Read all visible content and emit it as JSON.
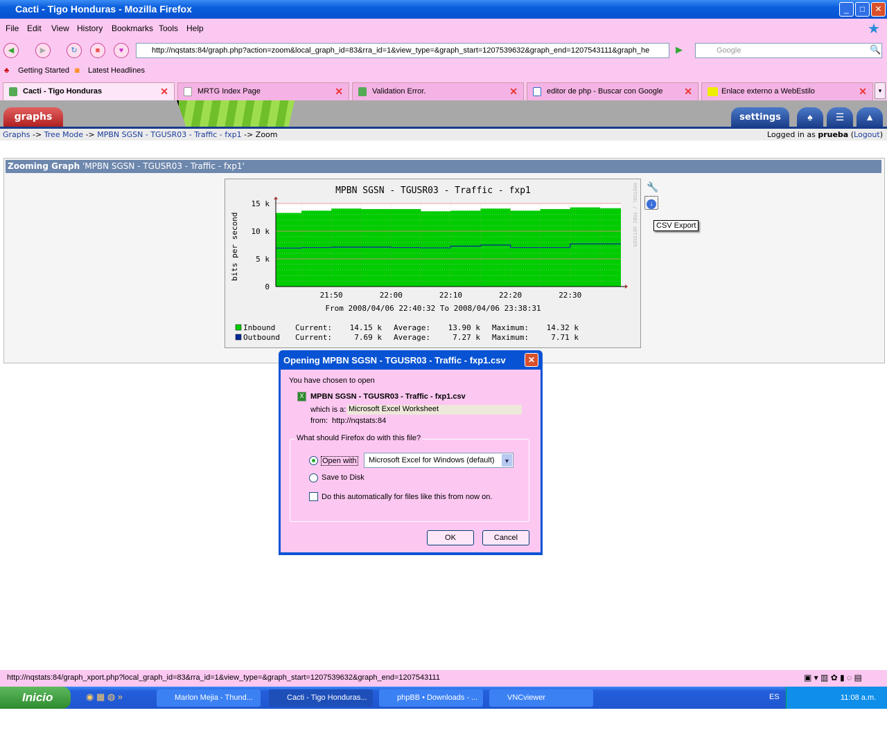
{
  "window": {
    "title": "Cacti - Tigo Honduras - Mozilla Firefox"
  },
  "menu": [
    "File",
    "Edit",
    "View",
    "History",
    "Bookmarks",
    "Tools",
    "Help"
  ],
  "url": "http://nqstats:84/graph.php?action=zoom&local_graph_id=83&rra_id=1&view_type=&graph_start=1207539632&graph_end=1207543111&graph_he",
  "search_placeholder": "Google",
  "bookmarks": [
    "Getting Started",
    "Latest Headlines"
  ],
  "tabs": [
    {
      "label": "Cacti - Tigo Honduras",
      "active": true
    },
    {
      "label": "MRTG Index Page"
    },
    {
      "label": "Validation Error."
    },
    {
      "label": "editor de php - Buscar con Google"
    },
    {
      "label": "Enlace externo a WebEstilo"
    }
  ],
  "cacti": {
    "graphs_tab": "graphs",
    "settings_tab": "settings",
    "breadcrumb": [
      "Graphs",
      "Tree Mode",
      "MPBN SGSN - TGUSR03 - Traffic - fxp1",
      "Zoom"
    ],
    "sep": "->",
    "logged_in_prefix": "Logged in as",
    "user": "prueba",
    "logout": "Logout",
    "zoom_heading": "Zooming Graph",
    "zoom_graph_name": "'MPBN SGSN - TGUSR03 - Traffic - fxp1'",
    "tooltip": "CSV Export"
  },
  "chart_data": {
    "type": "area",
    "title": "MPBN SGSN - TGUSR03 - Traffic - fxp1",
    "ylabel": "bits per second",
    "watermark": "RRDTOOL / TOBI OETIKER",
    "subtitle": "From 2008/04/06 22:40:32 To 2008/04/06 23:38:31",
    "yticks": [
      "0",
      "5 k",
      "10 k",
      "15 k"
    ],
    "ylim": [
      0,
      15000
    ],
    "xticks": [
      "21:50",
      "22:00",
      "22:10",
      "22:20",
      "22:30"
    ],
    "xlim": [
      "21:40:42",
      "22:38:30"
    ],
    "grid": true,
    "series": [
      {
        "name": "Inbound",
        "color": "#00cc00",
        "style": "area",
        "step_starts": [
          "21:40:42",
          "21:45",
          "21:50",
          "21:55",
          "22:05",
          "22:10",
          "22:15",
          "22:20",
          "22:25",
          "22:30",
          "22:35"
        ],
        "values": [
          13300,
          13700,
          14100,
          14000,
          13600,
          13700,
          14100,
          13700,
          14000,
          14300,
          14150
        ]
      },
      {
        "name": "Outbound",
        "color": "#002a97",
        "style": "line",
        "step_starts": [
          "21:40:42",
          "21:45",
          "21:50",
          "22:00",
          "22:05",
          "22:10",
          "22:15",
          "22:20",
          "22:30"
        ],
        "values": [
          6950,
          7050,
          7100,
          7050,
          7000,
          7300,
          7500,
          7050,
          7700
        ]
      }
    ],
    "legend": [
      {
        "name": "Inbound",
        "current": "14.15 k",
        "average": "13.90 k",
        "maximum": "14.32 k"
      },
      {
        "name": "Outbound",
        "current": "7.69 k",
        "average": "7.27 k",
        "maximum": "7.71 k"
      }
    ],
    "legend_labels": {
      "current": "Current:",
      "average": "Average:",
      "maximum": "Maximum:"
    }
  },
  "dialog": {
    "title": "Opening MPBN SGSN - TGUSR03 - Traffic - fxp1.csv",
    "intro": "You have chosen to open",
    "filename": "MPBN SGSN - TGUSR03 - Traffic - fxp1.csv",
    "which_is_label": "which is a:",
    "which_is": "Microsoft Excel Worksheet",
    "from_label": "from:",
    "from": "http://nqstats:84",
    "group_label": "What should Firefox do with this file?",
    "open_with": "Open with",
    "open_with_app": "Microsoft Excel for Windows (default)",
    "save_to_disk": "Save to Disk",
    "auto": "Do this automatically for files like this from now on.",
    "ok": "OK",
    "cancel": "Cancel"
  },
  "statusbar": "http://nqstats:84/graph_xport.php?local_graph_id=83&rra_id=1&view_type=&graph_start=1207539632&graph_end=1207543111",
  "taskbar": {
    "start": "Inicio",
    "tasks": [
      "Marlon Mejia - Thund...",
      "Cacti - Tigo Honduras...",
      "phpBB • Downloads - ...",
      "VNCviewer"
    ],
    "lang": "ES",
    "clock": "11:08 a.m."
  }
}
